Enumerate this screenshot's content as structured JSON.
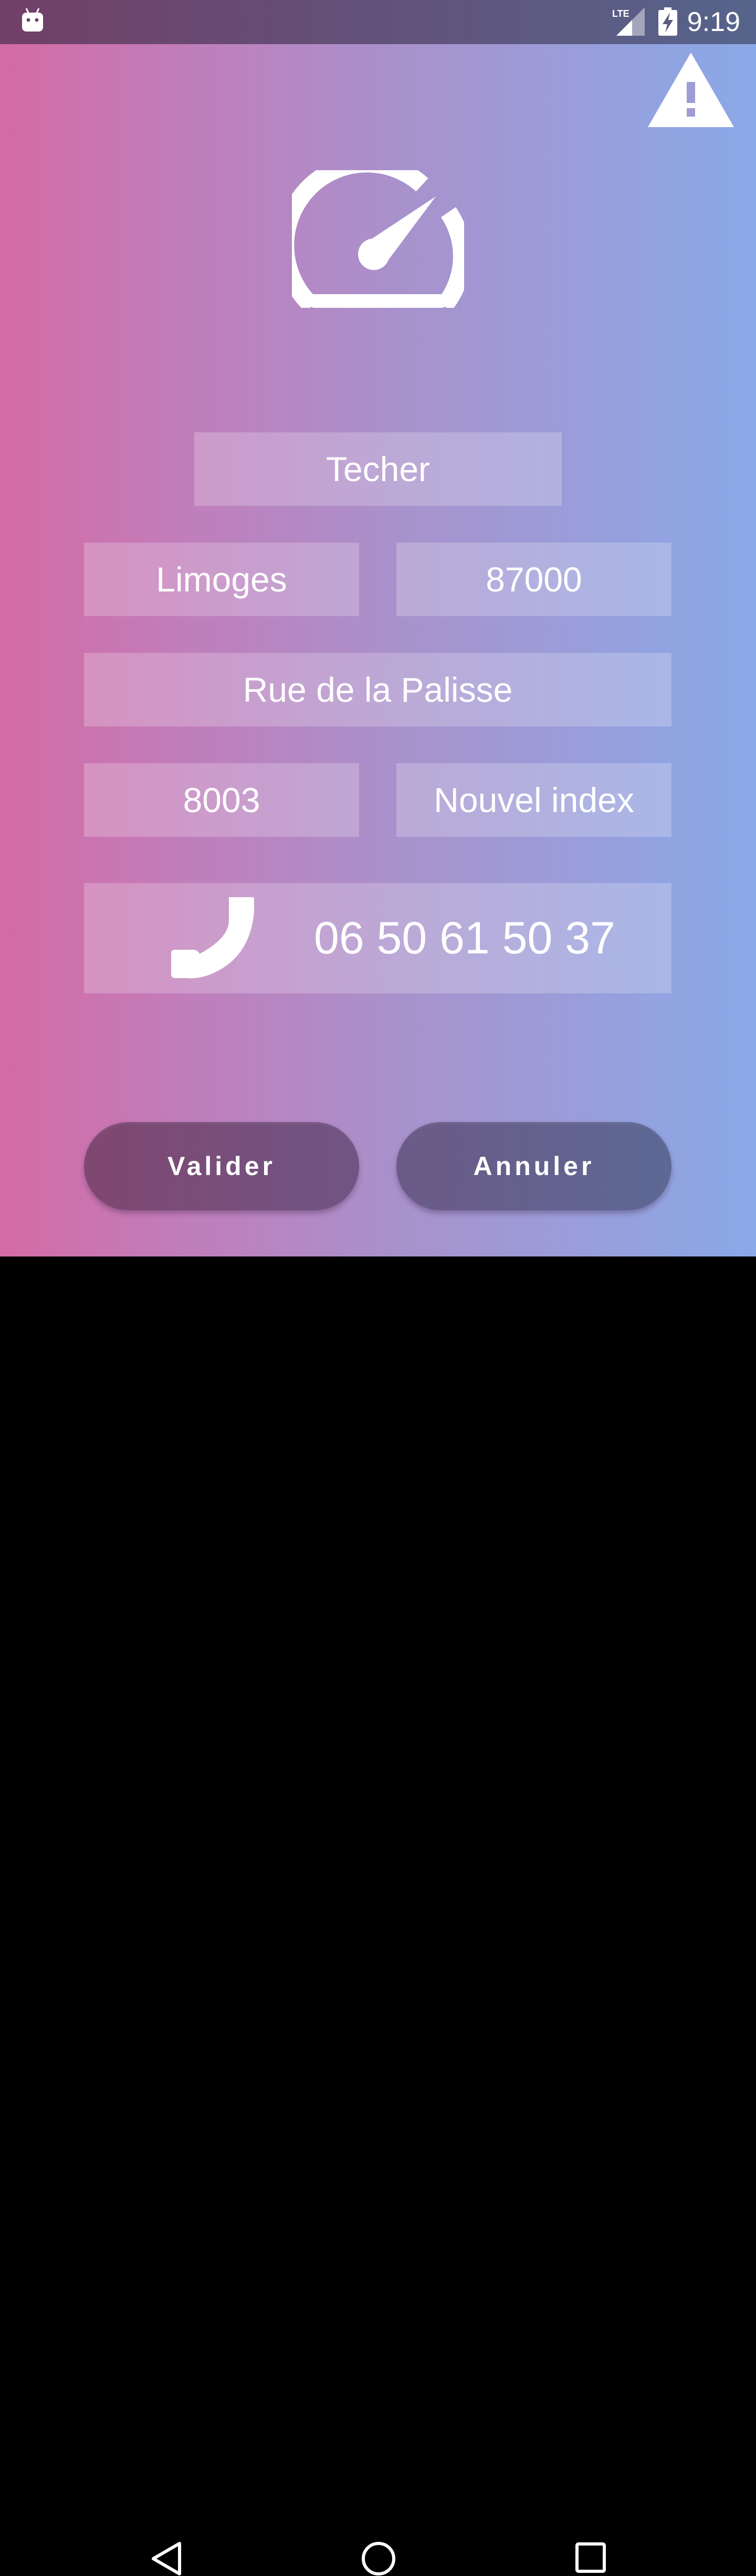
{
  "status_bar": {
    "time": "9:19",
    "network": "LTE",
    "icons": [
      "android-icon",
      "lte-signal-icon",
      "battery-charging-icon"
    ]
  },
  "header": {
    "warning_icon": "warning-icon",
    "main_icon": "speedometer-icon"
  },
  "form": {
    "name": "Techer",
    "city": "Limoges",
    "postal_code": "87000",
    "street": "Rue de la Palisse",
    "old_index": "8003",
    "new_index_placeholder": "Nouvel index",
    "phone_icon": "phone-icon",
    "phone": "06 50 61 50 37"
  },
  "actions": {
    "validate_label": "Valider",
    "cancel_label": "Annuler"
  },
  "nav_bar": {
    "icons": [
      "back-icon",
      "home-icon",
      "recents-icon"
    ]
  },
  "colors": {
    "gradient_left": "#d46ba5",
    "gradient_mid": "#a793cd",
    "gradient_right": "#8aa9e8",
    "field_bg": "rgba(255,255,255,0.22)",
    "button_validate": "#7f4771",
    "button_cancel": "#5d6894"
  }
}
